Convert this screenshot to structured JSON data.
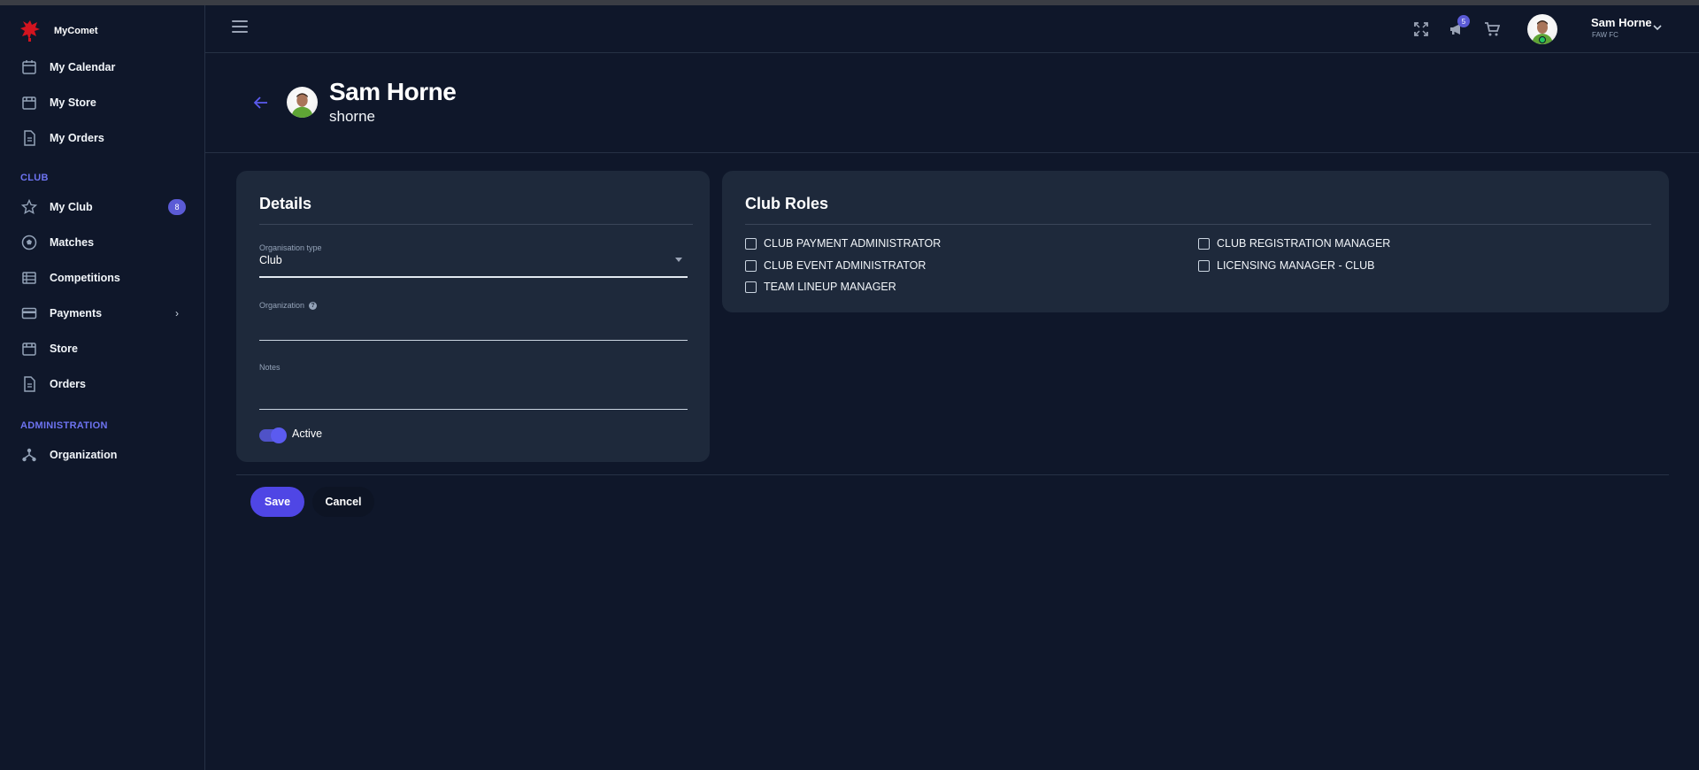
{
  "app": {
    "name": "MyComet"
  },
  "sidebar": {
    "items_top": [
      {
        "label": "My Calendar",
        "icon": "calendar-icon"
      },
      {
        "label": "My Store",
        "icon": "store-icon"
      },
      {
        "label": "My Orders",
        "icon": "orders-icon"
      }
    ],
    "club_section": "CLUB",
    "club_items": [
      {
        "label": "My Club",
        "icon": "star-icon",
        "badge": "8"
      },
      {
        "label": "Matches",
        "icon": "ball-icon"
      },
      {
        "label": "Competitions",
        "icon": "table-icon"
      },
      {
        "label": "Payments",
        "icon": "card-icon",
        "chevron": "›"
      },
      {
        "label": "Store",
        "icon": "store-icon"
      },
      {
        "label": "Orders",
        "icon": "orders-icon"
      }
    ],
    "admin_section": "ADMINISTRATION",
    "admin_items": [
      {
        "label": "Organization",
        "icon": "hierarchy-icon"
      }
    ]
  },
  "header": {
    "notifications_count": "5",
    "user_name": "Sam Horne",
    "user_org": "FAW FC"
  },
  "page": {
    "name": "Sam Horne",
    "username": "shorne"
  },
  "details": {
    "title": "Details",
    "org_type_label": "Organisation type",
    "org_type_value": "Club",
    "organization_label": "Organization",
    "organization_value": "",
    "notes_label": "Notes",
    "notes_value": "",
    "active_label": "Active",
    "active": true
  },
  "roles": {
    "title": "Club Roles",
    "items": [
      {
        "label": "CLUB PAYMENT ADMINISTRATOR",
        "checked": false
      },
      {
        "label": "CLUB EVENT ADMINISTRATOR",
        "checked": false
      },
      {
        "label": "TEAM LINEUP MANAGER",
        "checked": false
      },
      {
        "label": "CLUB REGISTRATION MANAGER",
        "checked": false
      },
      {
        "label": "LICENSING MANAGER - CLUB",
        "checked": false
      }
    ]
  },
  "actions": {
    "save": "Save",
    "cancel": "Cancel"
  },
  "colors": {
    "background": "#0f172a",
    "card": "#1e293b",
    "accent": "#4f46e5",
    "section_title": "#6d73f0"
  }
}
